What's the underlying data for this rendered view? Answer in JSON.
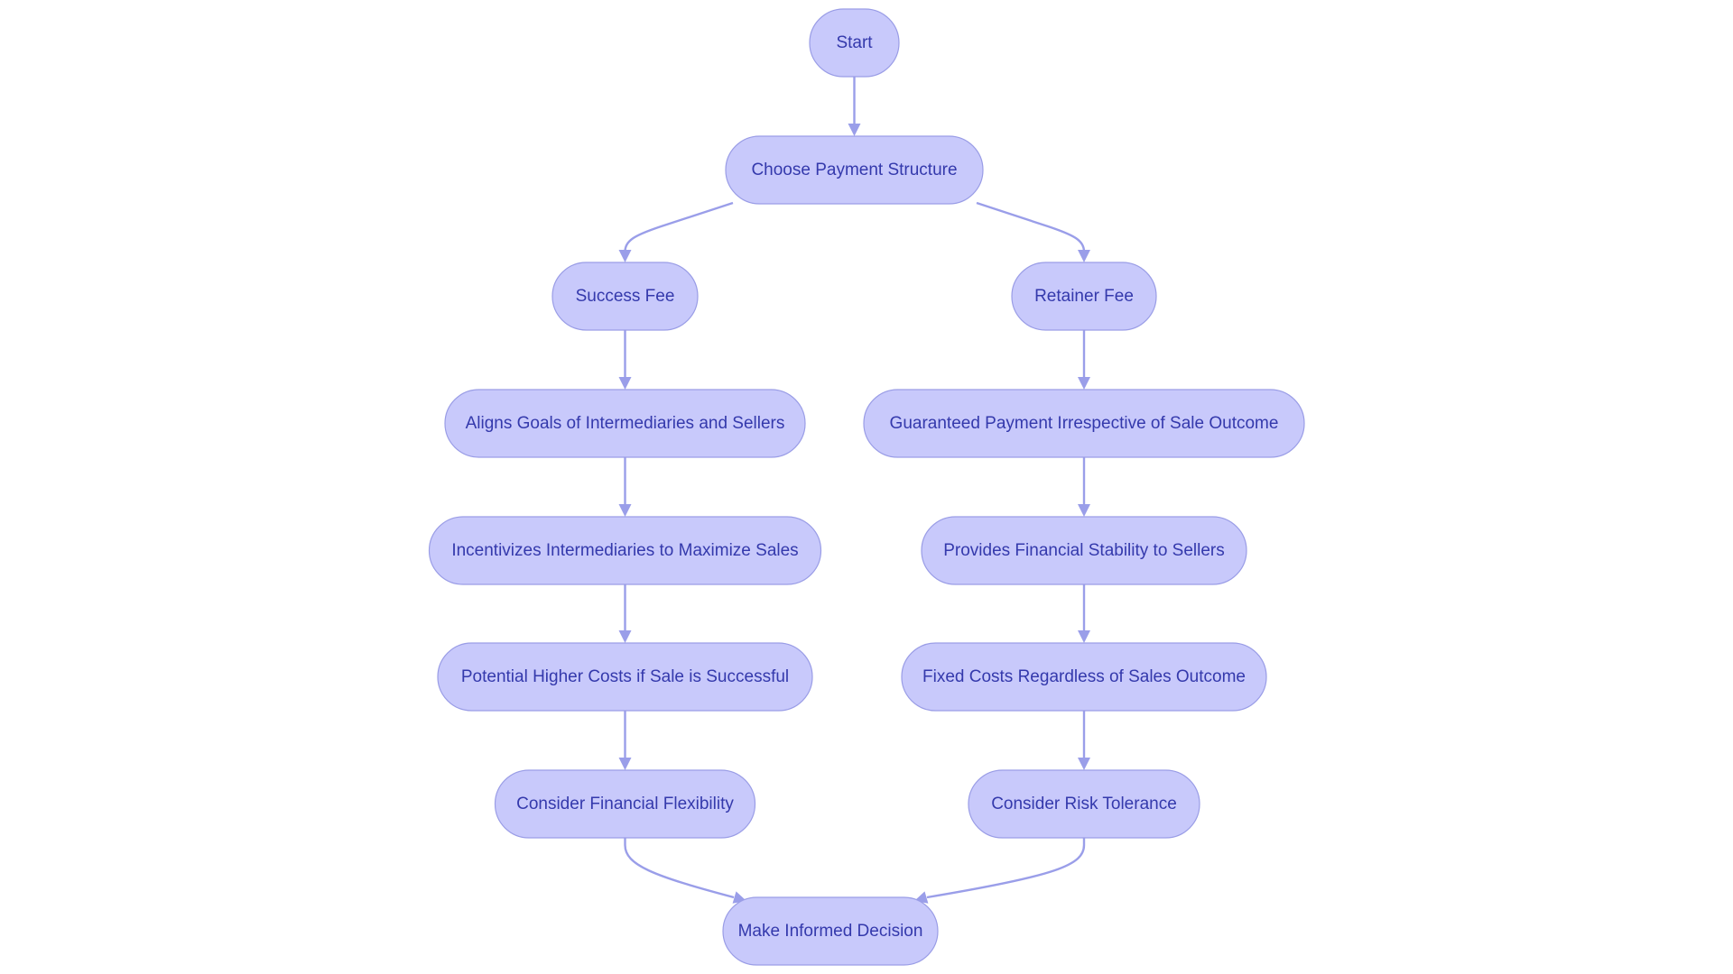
{
  "diagram": {
    "type": "flowchart",
    "direction": "top-down",
    "colors": {
      "node_fill": "#c8c9fb",
      "node_stroke": "#9a9de6",
      "text": "#3439ac",
      "edge": "#9a9ee9",
      "background": "#ffffff"
    },
    "nodes": [
      {
        "id": "start",
        "label": "Start"
      },
      {
        "id": "choose",
        "label": "Choose Payment Structure"
      },
      {
        "id": "success_fee",
        "label": "Success Fee"
      },
      {
        "id": "retainer_fee",
        "label": "Retainer Fee"
      },
      {
        "id": "aligns_goals",
        "label": "Aligns Goals of Intermediaries and Sellers"
      },
      {
        "id": "guaranteed_payment",
        "label": "Guaranteed Payment Irrespective of Sale Outcome"
      },
      {
        "id": "incentivizes",
        "label": "Incentivizes Intermediaries to Maximize Sales"
      },
      {
        "id": "stability",
        "label": "Provides Financial Stability to Sellers"
      },
      {
        "id": "higher_costs",
        "label": "Potential Higher Costs if Sale is Successful"
      },
      {
        "id": "fixed_costs",
        "label": "Fixed Costs Regardless of Sales Outcome"
      },
      {
        "id": "flexibility",
        "label": "Consider Financial Flexibility"
      },
      {
        "id": "risk_tolerance",
        "label": "Consider Risk Tolerance"
      },
      {
        "id": "decision",
        "label": "Make Informed Decision"
      }
    ],
    "edges": [
      {
        "from": "start",
        "to": "choose"
      },
      {
        "from": "choose",
        "to": "success_fee"
      },
      {
        "from": "choose",
        "to": "retainer_fee"
      },
      {
        "from": "success_fee",
        "to": "aligns_goals"
      },
      {
        "from": "retainer_fee",
        "to": "guaranteed_payment"
      },
      {
        "from": "aligns_goals",
        "to": "incentivizes"
      },
      {
        "from": "guaranteed_payment",
        "to": "stability"
      },
      {
        "from": "incentivizes",
        "to": "higher_costs"
      },
      {
        "from": "stability",
        "to": "fixed_costs"
      },
      {
        "from": "higher_costs",
        "to": "flexibility"
      },
      {
        "from": "fixed_costs",
        "to": "risk_tolerance"
      },
      {
        "from": "flexibility",
        "to": "decision"
      },
      {
        "from": "risk_tolerance",
        "to": "decision"
      }
    ]
  }
}
